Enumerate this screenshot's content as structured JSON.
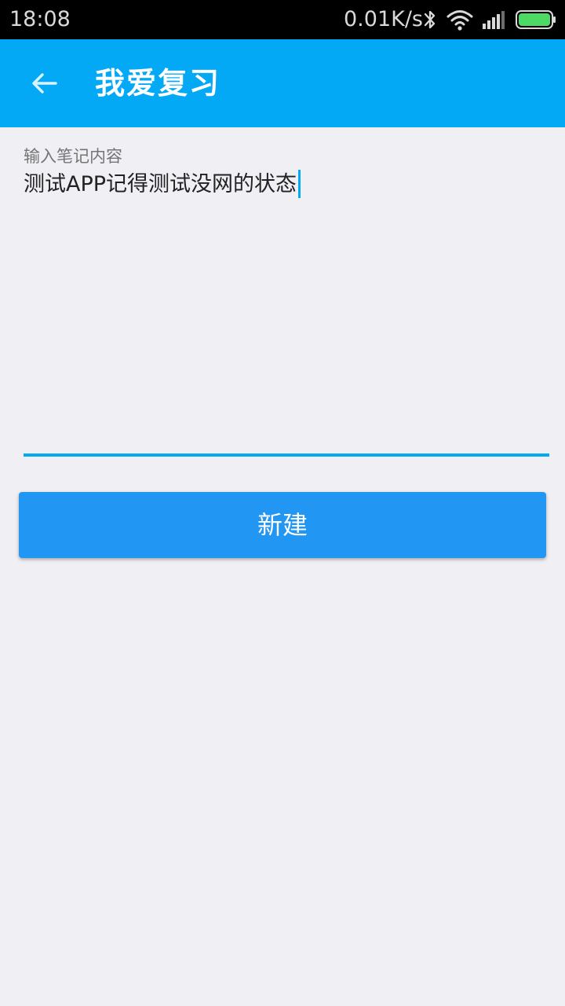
{
  "status_bar": {
    "time": "18:08",
    "network_speed": "0.01K/s",
    "icons": [
      "bluetooth-icon",
      "wifi-icon",
      "signal-icon",
      "battery-icon"
    ]
  },
  "toolbar": {
    "back_icon": "arrow-left-icon",
    "title": "我爱复习"
  },
  "note_form": {
    "hint": "输入笔记内容",
    "value": "测试APP记得测试没网的状态",
    "submit_label": "新建"
  },
  "colors": {
    "status_bar": "#000000",
    "toolbar": "#03a9f4",
    "background": "#efeff4",
    "accent": "#03a9f4",
    "button": "#2196f3"
  }
}
